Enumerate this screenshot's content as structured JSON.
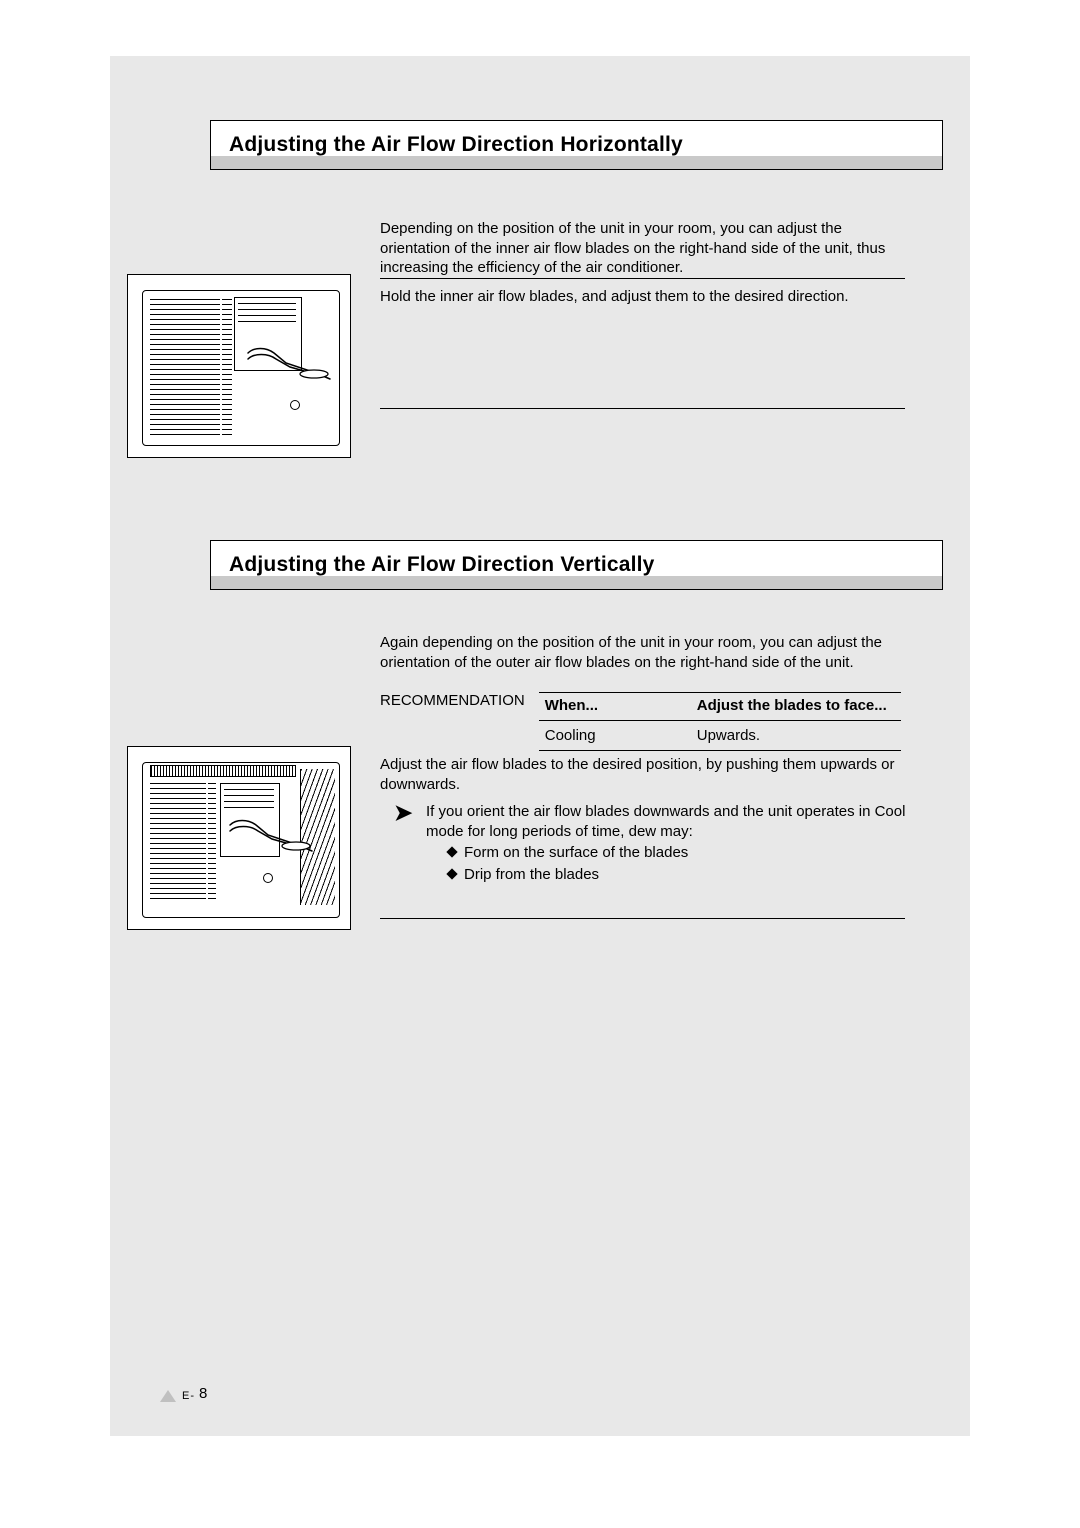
{
  "section1": {
    "title": "Adjusting the Air Flow Direction Horizontally",
    "intro": "Depending on the position of the unit in your room, you can adjust the orientation of the inner air flow blades on the right-hand side of the unit, thus increasing the efficiency of the air conditioner.",
    "step": "Hold the inner air flow blades, and adjust them to the desired direction."
  },
  "section2": {
    "title": "Adjusting the Air Flow Direction Vertically",
    "intro": "Again depending on the position of the unit in your room, you can adjust the orientation of the outer air flow blades on the right-hand side of the unit.",
    "rec_label": "RECOMMENDATION",
    "table": {
      "head_when": "When...",
      "head_adjust": "Adjust the blades to face...",
      "row1_when": "Cooling",
      "row1_adjust": "Upwards."
    },
    "step": "Adjust the air flow blades to the desired position, by pushing them upwards or downwards.",
    "note": "If you orient the air flow blades downwards and the unit operates in Cool mode for long periods of time, dew may:",
    "bullet1": "Form on the surface of the blades",
    "bullet2": "Drip from the blades"
  },
  "footer": {
    "prefix": "E-",
    "page": "8"
  }
}
